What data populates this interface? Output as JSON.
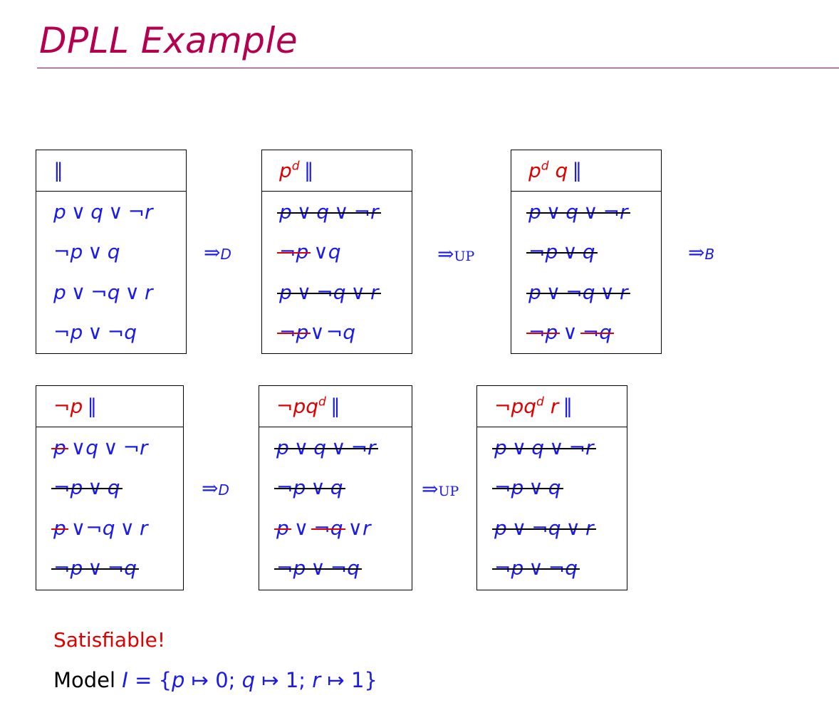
{
  "title": "DPLL Example",
  "boxes": [
    {
      "head": "∥",
      "clauses": [
        "p ∨ q ∨ ¬r",
        "¬p ∨ q",
        "p ∨ ¬q ∨ r",
        "¬p ∨ ¬q"
      ]
    },
    {
      "head": "p^d ∥",
      "clauses": [
        "p ∨ q ∨ ¬r",
        "¬p ∨q",
        "p ∨ ¬q ∨ r",
        "¬p∨¬q"
      ]
    },
    {
      "head": "p^d q ∥",
      "clauses": [
        "p ∨ q ∨ ¬r",
        "¬p ∨ q",
        "p ∨ ¬q ∨ r",
        "¬p ∨ ¬q"
      ]
    },
    {
      "head": "¬p ∥",
      "clauses": [
        "p ∨q ∨ ¬r",
        "¬p ∨ q",
        "p ∨¬q ∨ r",
        "¬p ∨ ¬q"
      ]
    },
    {
      "head": "¬pq^d ∥",
      "clauses": [
        "p ∨ q ∨ ¬r",
        "¬p ∨ q",
        "p ∨ ¬q ∨r",
        "¬p ∨ ¬q"
      ]
    },
    {
      "head": "¬pq^d r ∥",
      "clauses": [
        "p ∨ q ∨ ¬r",
        "¬p ∨ q",
        "p ∨ ¬q ∨ r",
        "¬p ∨ ¬q"
      ]
    }
  ],
  "arrows": {
    "row1_a": {
      "symbol": "⇒",
      "sub": "D"
    },
    "row1_b": {
      "symbol": "⇒",
      "sub": "UP"
    },
    "row1_c": {
      "symbol": "⇒",
      "sub": "B"
    },
    "row2_a": {
      "symbol": "⇒",
      "sub": "D"
    },
    "row2_b": {
      "symbol": "⇒",
      "sub": "UP"
    }
  },
  "result": {
    "status": "Satisfiable!",
    "model_label": "Model",
    "model_expr": "I = {p ↦ 0; q ↦ 1; r ↦ 1}"
  },
  "colors": {
    "title": "#b5004f",
    "clause": "#1a1aee",
    "trail": "#e00000",
    "strike": "#000000"
  }
}
